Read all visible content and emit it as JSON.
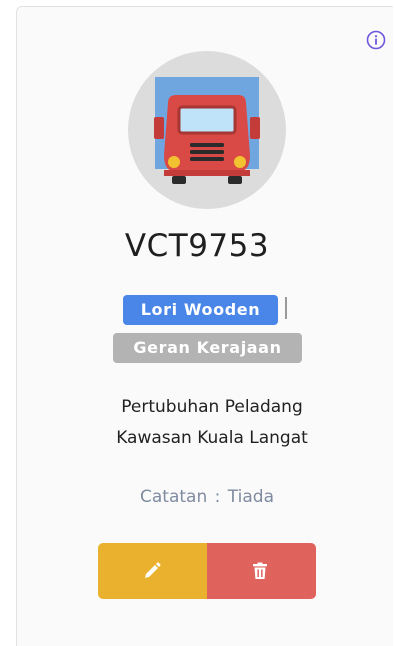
{
  "vehicle": {
    "plate_number": "VCT9753",
    "type_label": "Lori Wooden",
    "ownership_label": "Geran Kerajaan",
    "organization_line1": "Pertubuhan Peladang",
    "organization_line2": "Kawasan Kuala Langat",
    "note_label": "Catatan",
    "note_separator": ":",
    "note_value": "Tiada"
  },
  "icons": {
    "info": "info-circle-icon",
    "avatar": "truck-icon",
    "edit": "pencil-icon",
    "delete": "trash-icon"
  },
  "colors": {
    "info_icon": "#6f55d9",
    "type_badge": "#4a86e8",
    "ownership_badge": "#b3b3b3",
    "edit_button": "#e9b12e",
    "delete_button": "#e0625c",
    "note_text": "#7f8ba0",
    "truck_cab": "#d94a46",
    "truck_cargo": "#6fa6e0"
  }
}
